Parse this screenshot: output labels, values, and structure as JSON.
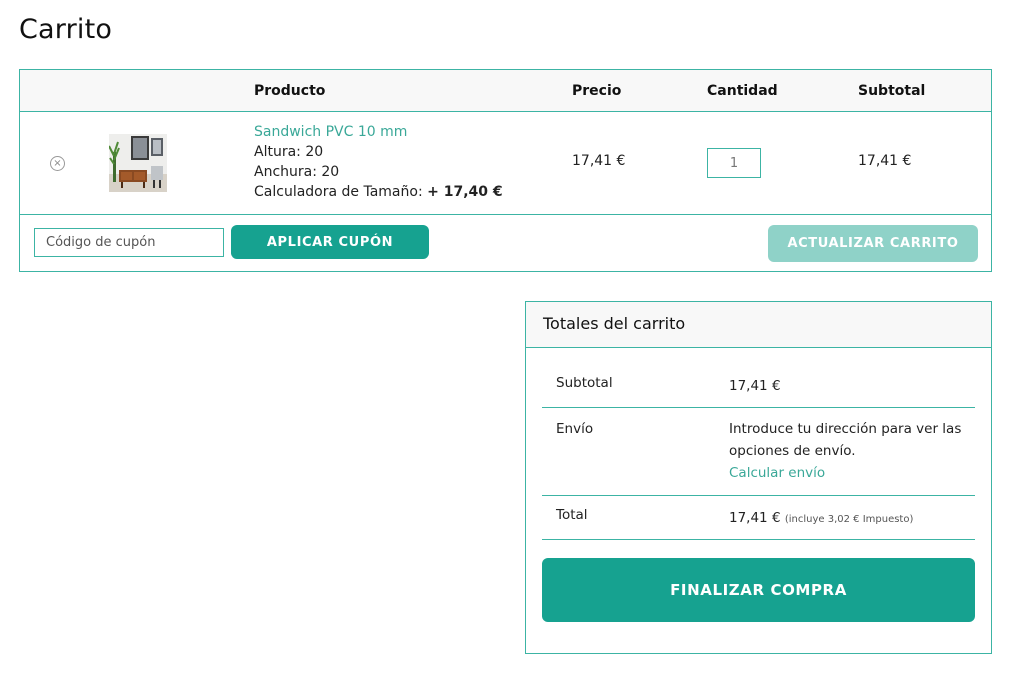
{
  "page": {
    "title": "Carrito"
  },
  "cart": {
    "headers": {
      "product": "Producto",
      "price": "Precio",
      "quantity": "Cantidad",
      "subtotal": "Subtotal"
    },
    "items": [
      {
        "name": "Sandwich PVC 10 mm",
        "height_label": "Altura: 20",
        "width_label": "Anchura: 20",
        "size_calc_label": "Calculadora de Tamaño:",
        "size_calc_value": "+ 17,40 €",
        "price": "17,41 €",
        "quantity": "1",
        "subtotal": "17,41 €",
        "remove_icon": "close-circle-icon",
        "remove_symbol": "×"
      }
    ],
    "coupon_placeholder": "Código de cupón",
    "apply_coupon_label": "APLICAR CUPÓN",
    "update_cart_label": "ACTUALIZAR CARRITO"
  },
  "totals": {
    "title": "Totales del carrito",
    "subtotal_label": "Subtotal",
    "subtotal_value": "17,41 €",
    "shipping_label": "Envío",
    "shipping_text": "Introduce tu dirección para ver las opciones de envío.",
    "shipping_link": "Calcular envío",
    "total_label": "Total",
    "total_value": "17,41 €",
    "tax_note": "(incluye 3,02 € Impuesto)",
    "checkout_label": "FINALIZAR COMPRA"
  },
  "colors": {
    "accent": "#16a290",
    "accent_light": "#8fd2c8",
    "border": "#3cb4a4",
    "link": "#3aa898"
  }
}
